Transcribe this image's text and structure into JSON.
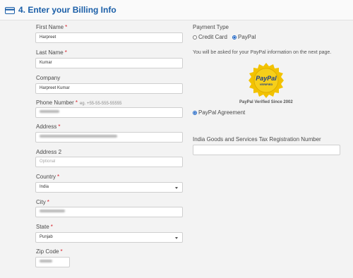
{
  "section": {
    "title": "4. Enter your Billing Info",
    "icon": "credit-card-icon"
  },
  "left": {
    "first_name": {
      "label": "First Name",
      "value": "Harpreet"
    },
    "last_name": {
      "label": "Last Name",
      "value": "Kumar"
    },
    "company": {
      "label": "Company",
      "value": "Harpreet Kumar"
    },
    "phone": {
      "label": "Phone Number",
      "hint": "eg. +55-55-555-55555"
    },
    "address": {
      "label": "Address"
    },
    "address2": {
      "label": "Address 2",
      "placeholder": "Optional"
    },
    "country": {
      "label": "Country",
      "value": "India"
    },
    "city": {
      "label": "City"
    },
    "state": {
      "label": "State",
      "value": "Punjab"
    },
    "zip": {
      "label": "Zip Code"
    }
  },
  "right": {
    "payment_type_label": "Payment Type",
    "option_credit": "Credit Card",
    "option_paypal": "PayPal",
    "selected": "PayPal",
    "paypal_note": "You will be asked for your PayPal information on the next page.",
    "seal_brand": "PayPal",
    "seal_sub": "VERIFIED",
    "verified_since": "PayPal Verified Since 2002",
    "agreement": "PayPal Agreement",
    "gst_label": "India Goods and Services Tax Registration Number"
  },
  "colors": {
    "accent": "#1b5fa8",
    "required": "#d9232d",
    "seal": "#f2c200"
  }
}
